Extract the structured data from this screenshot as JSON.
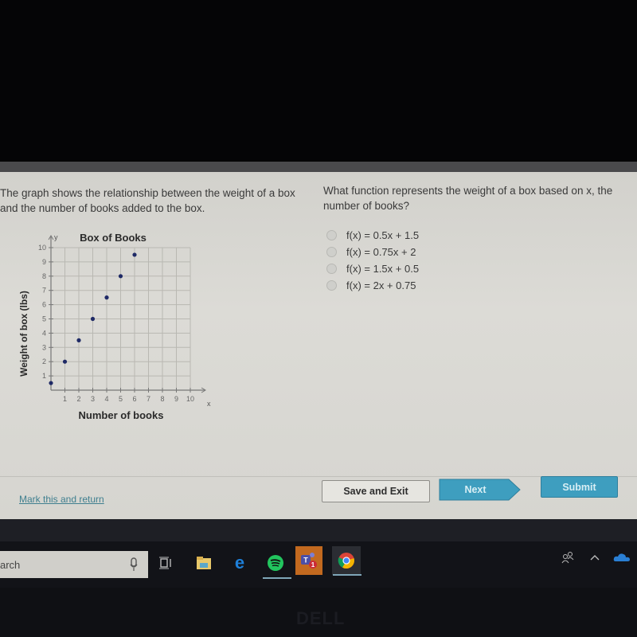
{
  "question": {
    "prompt_left": "The graph shows the relationship between the weight of a box and the number of books added to the box.",
    "prompt_right": "What function represents the weight of a box based on x, the number of books?",
    "options": [
      {
        "label": "f(x) = 0.5x + 1.5",
        "selected": false
      },
      {
        "label": "f(x) = 0.75x + 2",
        "selected": false
      },
      {
        "label": "f(x) = 1.5x + 0.5",
        "selected": false
      },
      {
        "label": "f(x) = 2x + 0.75",
        "selected": false
      }
    ]
  },
  "chart_data": {
    "type": "scatter",
    "title": "Box of Books",
    "xlabel": "Number of books",
    "ylabel": "Weight of box (lbs)",
    "x_axis_letter": "x",
    "y_axis_letter": "y",
    "xlim": [
      0,
      10
    ],
    "ylim": [
      0,
      10
    ],
    "x_ticks": [
      1,
      2,
      3,
      4,
      5,
      6,
      7,
      8,
      9,
      10
    ],
    "y_ticks": [
      1,
      2,
      3,
      4,
      5,
      6,
      7,
      8,
      9,
      10
    ],
    "grid": true,
    "points": [
      {
        "x": 0,
        "y": 0.5
      },
      {
        "x": 1,
        "y": 2
      },
      {
        "x": 2,
        "y": 3.5
      },
      {
        "x": 3,
        "y": 5
      },
      {
        "x": 4,
        "y": 6.5
      },
      {
        "x": 5,
        "y": 8
      },
      {
        "x": 6,
        "y": 9.5
      }
    ],
    "point_color": "#1f2a66"
  },
  "footer": {
    "mark_link": "Mark this and return",
    "save_exit": "Save and Exit",
    "next": "Next",
    "submit": "Submit",
    "button_color": "#3e9ebf"
  },
  "taskbar": {
    "search_text": "arch",
    "icons": [
      "task-view-icon",
      "file-explorer-icon",
      "edge-icon",
      "spotify-icon",
      "teams-icon",
      "chrome-icon"
    ],
    "teams_badge": "1",
    "tray": [
      "people-icon",
      "chevron-up-icon",
      "onedrive-icon"
    ]
  },
  "monitor": {
    "brand": "DELL"
  }
}
